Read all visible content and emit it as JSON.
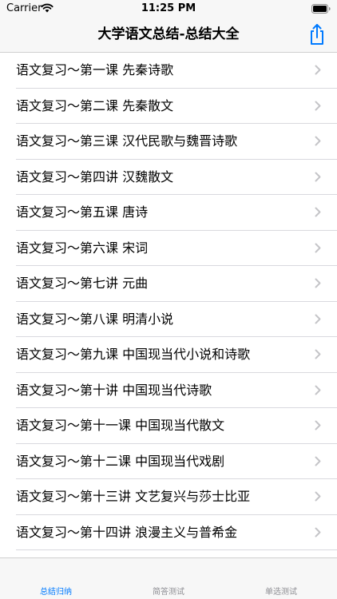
{
  "status_bar": {
    "carrier": "Carrier",
    "time": "11:25 PM"
  },
  "nav": {
    "title": "大学语文总结-总结大全",
    "share_icon": "share-icon"
  },
  "colors": {
    "accent": "#007aff",
    "inactive_tab": "#8e8e93",
    "separator": "#d9d9de",
    "bar_background": "#f7f7f7",
    "chevron": "#c4c4c7"
  },
  "lessons": [
    "语文复习～第一课 先秦诗歌",
    "语文复习～第二课 先秦散文",
    "语文复习～第三课 汉代民歌与魏晋诗歌",
    "语文复习～第四讲 汉魏散文",
    "语文复习～第五课 唐诗",
    "语文复习～第六课 宋词",
    "语文复习～第七讲 元曲",
    "语文复习～第八课 明清小说",
    "语文复习～第九课 中国现当代小说和诗歌",
    "语文复习～第十讲 中国现当代诗歌",
    "语文复习～第十一课 中国现当代散文",
    "语文复习～第十二课 中国现当代戏剧",
    "语文复习～第十三讲 文艺复兴与莎士比亚",
    "语文复习～第十四讲 浪漫主义与普希金"
  ],
  "tabs": [
    {
      "label": "总结归纳",
      "active": true
    },
    {
      "label": "简答测试",
      "active": false
    },
    {
      "label": "单选测试",
      "active": false
    }
  ]
}
